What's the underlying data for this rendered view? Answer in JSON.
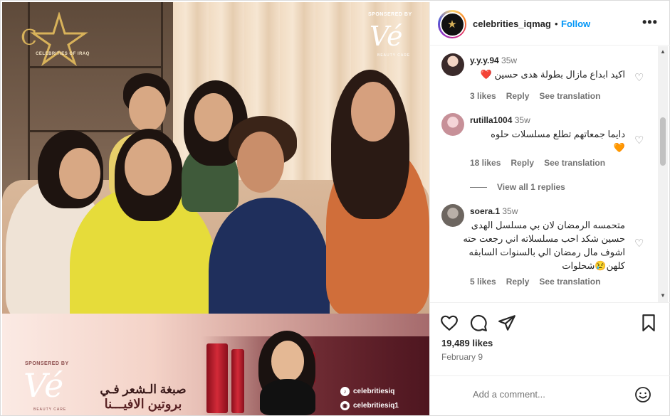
{
  "post_image": {
    "logo_text": "CELEBRITIES OF IRAQ",
    "sponsor_top": "SPONSERED BY",
    "brand_top": "Vé",
    "beauty_care_top": "BEAUTY CARE",
    "sponsor_bottom": "SPONSERED BY",
    "brand_bottom": "Vé",
    "beauty_care_bottom": "BEAUTY CARE",
    "ad_line1": "صبغة الـشعر فـي",
    "ad_line2": "بروتين الافيـــنا",
    "social_tiktok": "celebritiesiq",
    "social_snap": "celebritiesiq1"
  },
  "header": {
    "username": "celebrities_iqmag",
    "separator": "•",
    "follow_label": "Follow",
    "more_label": "•••"
  },
  "comments": [
    {
      "username": "y.y.y.94",
      "time": "35w",
      "text": "اكيد ابداع مازال بطولة هدى حسين",
      "emoji": "❤️",
      "likes": "3 likes",
      "reply": "Reply",
      "translate": "See translation"
    },
    {
      "username": "rutilla1004",
      "time": "35w",
      "text": "دايما جمعاتهم تطلع مسلسلات حلوه",
      "emoji": "🧡",
      "likes": "18 likes",
      "reply": "Reply",
      "translate": "See translation",
      "view_replies": "View all 1 replies"
    },
    {
      "username": "soera.1",
      "time": "35w",
      "text": "متحمسه الرمضان لان بي مسلسل الهدى حسين شكد احب مسلسلاته اني رجعت حته اشوف مال رمضان الي بالسنوات السابقه كلهن😢شحلوات",
      "likes": "5 likes",
      "reply": "Reply",
      "translate": "See translation"
    }
  ],
  "actions": {
    "likes": "19,489 likes",
    "date": "February 9"
  },
  "add_comment": {
    "placeholder": "Add a comment..."
  },
  "colors": {
    "follow_blue": "#0095f6",
    "muted_text": "#737373",
    "primary_text": "#262626"
  }
}
